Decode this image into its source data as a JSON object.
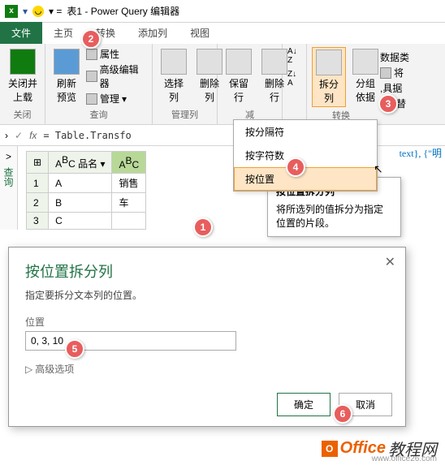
{
  "window": {
    "title": "表1 - Power Query 编辑器"
  },
  "tabs": {
    "file": "文件",
    "home": "主页",
    "transform": "转换",
    "addcol": "添加列",
    "view": "视图"
  },
  "ribbon": {
    "close": {
      "btn": "关闭并\n上载",
      "group": "关闭"
    },
    "query": {
      "refresh": "刷新\n预览",
      "props": "属性",
      "adveditor": "高级编辑器",
      "manage": "管理",
      "group": "查询"
    },
    "cols": {
      "select": "选择\n列",
      "remove": "删除\n列",
      "group": "管理列"
    },
    "rows": {
      "keep": "保留\n行",
      "remove": "删除\n行",
      "group": "减"
    },
    "sort": {
      "asc": "A↑Z",
      "desc": "Z↓A"
    },
    "split": {
      "btn": "拆分\n列",
      "group_btn": "分组\n依据",
      "group": "转换"
    },
    "data": {
      "type": "数据类",
      "row1": "将",
      "use": ",具据",
      "rep": "1,2 替"
    }
  },
  "formula": {
    "text": "= Table.Transfo"
  },
  "codehint": "text}, {\"明",
  "lefttabs": {
    "a": ">",
    "b": "查询"
  },
  "table": {
    "col1": "品名",
    "col2h1": "销售",
    "col2h2": "车",
    "rows": [
      {
        "n": "1",
        "v": "A"
      },
      {
        "n": "2",
        "v": "B"
      },
      {
        "n": "3",
        "v": "C"
      }
    ]
  },
  "dropdown": {
    "delim": "按分隔符",
    "chars": "按字符数",
    "pos": "按位置"
  },
  "tooltip": {
    "title": "按位置拆分列",
    "body": "将所选列的值拆分为指定位置的片段。"
  },
  "dialog": {
    "title": "按位置拆分列",
    "desc": "指定要拆分文本列的位置。",
    "label": "位置",
    "value": "0, 3, 10",
    "adv": "高级选项",
    "ok": "确定",
    "cancel": "取消"
  },
  "badges": {
    "b1": "1",
    "b2": "2",
    "b3": "3",
    "b4": "4",
    "b5": "5",
    "b6": "6"
  },
  "watermark": {
    "brand1": "Office",
    "brand2": "教程网",
    "url": "www.office26.com"
  }
}
